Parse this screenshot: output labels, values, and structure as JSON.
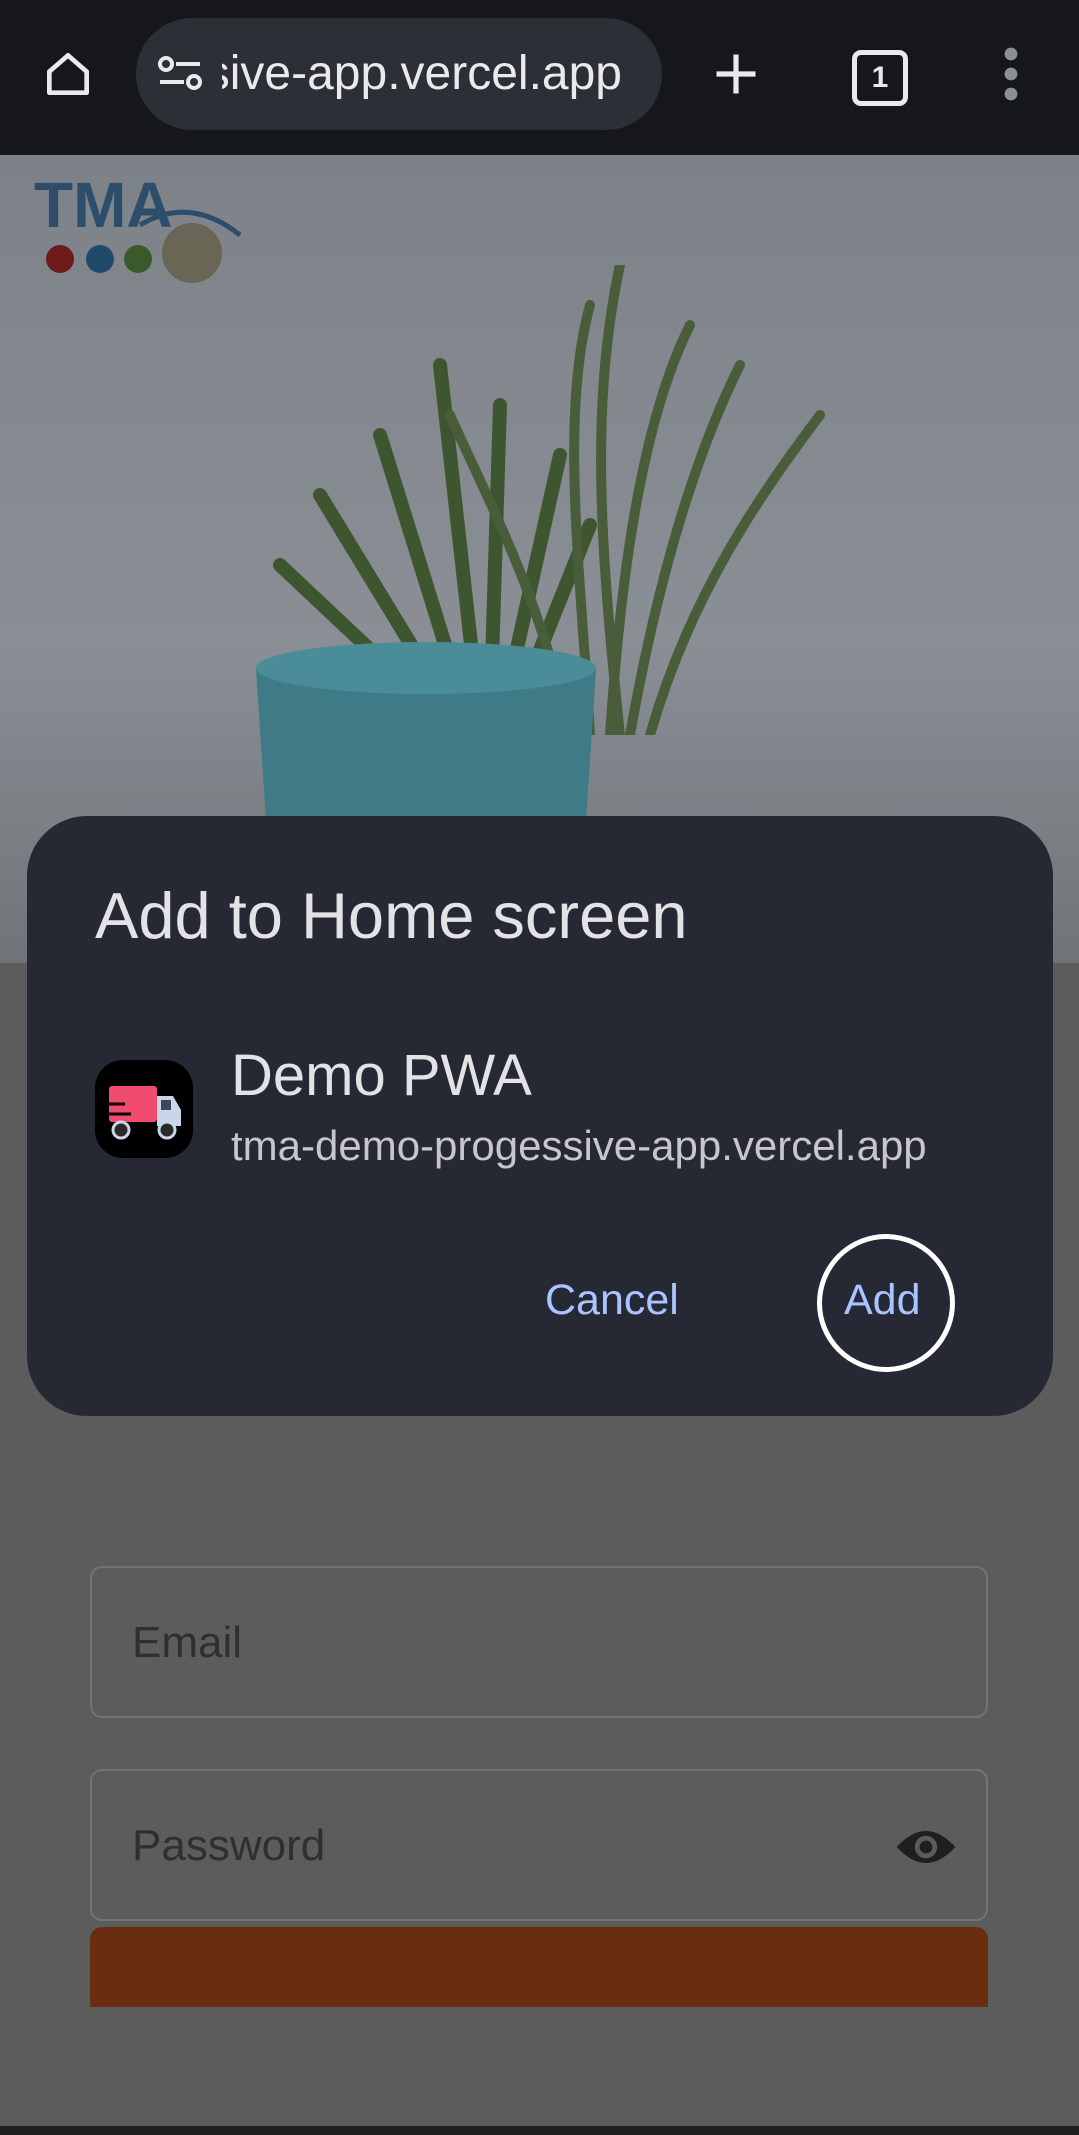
{
  "browser": {
    "url": "sive-app.vercel.app",
    "tab_count": "1"
  },
  "page": {
    "logo_text": "TMA",
    "email_placeholder": "Email",
    "password_placeholder": "Password"
  },
  "dialog": {
    "title": "Add to Home screen",
    "app_name": "Demo PWA",
    "app_url": "tma-demo-progessive-app.vercel.app",
    "cancel_label": "Cancel",
    "add_label": "Add"
  },
  "colors": {
    "dialog_bg": "#262833",
    "button_text": "#a9c5ff",
    "topbar_bg": "#16171b",
    "scrim": "#5b5b5b"
  },
  "icons": [
    "home-icon",
    "site-settings-icon",
    "new-tab-icon",
    "tab-switcher-icon",
    "more-options-icon",
    "truck-app-icon",
    "visibility-icon"
  ]
}
